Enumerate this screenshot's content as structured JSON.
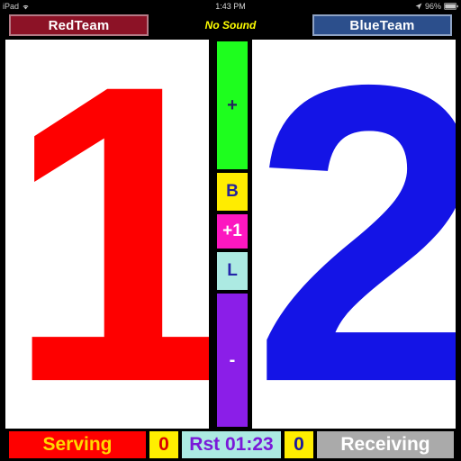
{
  "status_bar": {
    "carrier": "iPad",
    "wifi_icon": "wifi-icon",
    "time": "1:43 PM",
    "location_icon": "location-arrow-icon",
    "battery_percent": "96%",
    "battery_icon": "battery-icon"
  },
  "header": {
    "team_left": "RedTeam",
    "sound_status": "No Sound",
    "team_right": "BlueTeam"
  },
  "board": {
    "left_score": "1",
    "right_score": "2"
  },
  "controls": [
    {
      "id": "plus",
      "label": "+",
      "name": "increment-button"
    },
    {
      "id": "b",
      "label": "B",
      "name": "b-button"
    },
    {
      "id": "plus1",
      "label": "+1",
      "name": "plus-one-button"
    },
    {
      "id": "l",
      "label": "L",
      "name": "l-button"
    },
    {
      "id": "minus",
      "label": "-",
      "name": "decrement-button"
    }
  ],
  "bottom_bar": {
    "serving_label": "Serving",
    "left_sets": "0",
    "timer": "Rst 01:23",
    "right_sets": "0",
    "receiving_label": "Receiving"
  },
  "colors": {
    "red_score": "#fe0000",
    "blue_score": "#1414e6",
    "team_red_bg": "#8c1226",
    "team_blue_bg": "#2c4f8c",
    "plus_button": "#1efe1e",
    "b_button": "#ffec00",
    "plus1_button": "#fc17c0",
    "l_button": "#aceae2",
    "minus_button": "#8b1ee8",
    "serving_bg": "#fe0000",
    "receiving_bg": "#aaaaaa",
    "timer_bg": "#aceae2",
    "sets_bg": "#ffee00",
    "no_sound_text": "#ffff00"
  }
}
